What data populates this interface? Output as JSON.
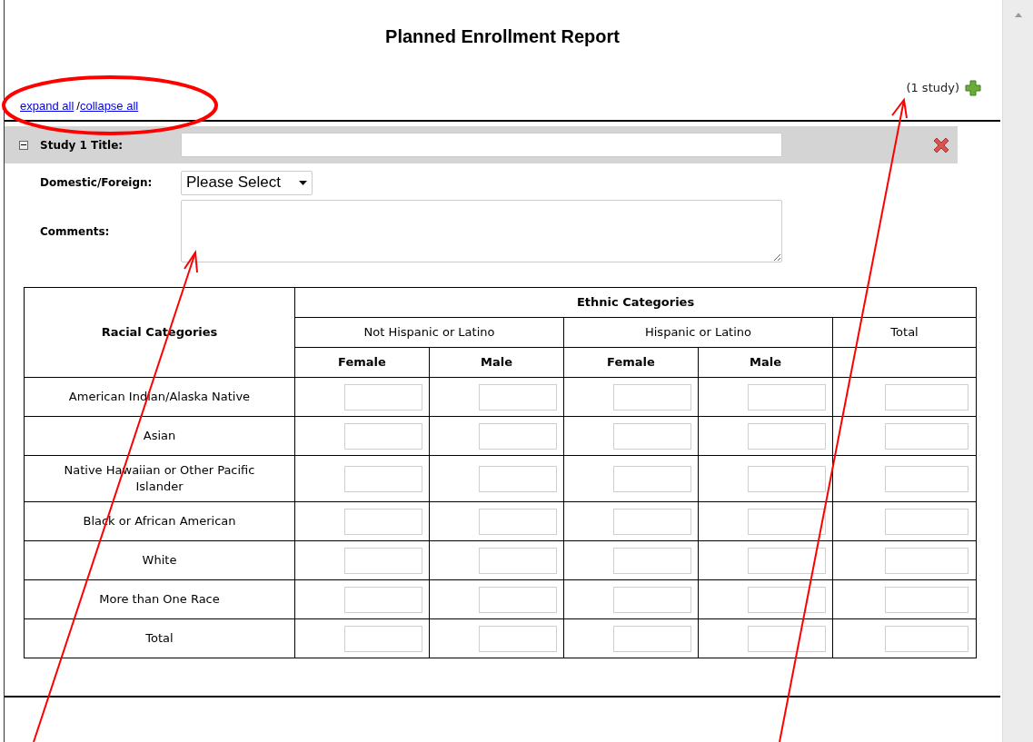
{
  "title": "Planned Enrollment Report",
  "study_count": "(1 study)",
  "links": [
    {
      "label": "expand all"
    },
    {
      "label": "collapse all"
    }
  ],
  "link_separator": "/",
  "study": {
    "expanded": true,
    "title_label": "Study 1 Title:",
    "domestic_label": "Domestic/Foreign:",
    "domestic_value": "Please Select",
    "comments_label": "Comments:"
  },
  "table": {
    "row_header": "Racial Categories",
    "group_header": "Ethnic Categories",
    "subgroups": [
      "Not Hispanic or Latino",
      "Hispanic or Latino",
      "Total"
    ],
    "subcolumns": [
      "Female",
      "Male",
      "Female",
      "Male"
    ],
    "rows": [
      {
        "label": "American Indian/Alaska Native"
      },
      {
        "label": "Asian"
      },
      {
        "label": "Native Hawaiian or Other Pacific Islander"
      },
      {
        "label": "Black or African American"
      },
      {
        "label": "White"
      },
      {
        "label": "More than One Race"
      },
      {
        "label": "Total"
      }
    ]
  }
}
